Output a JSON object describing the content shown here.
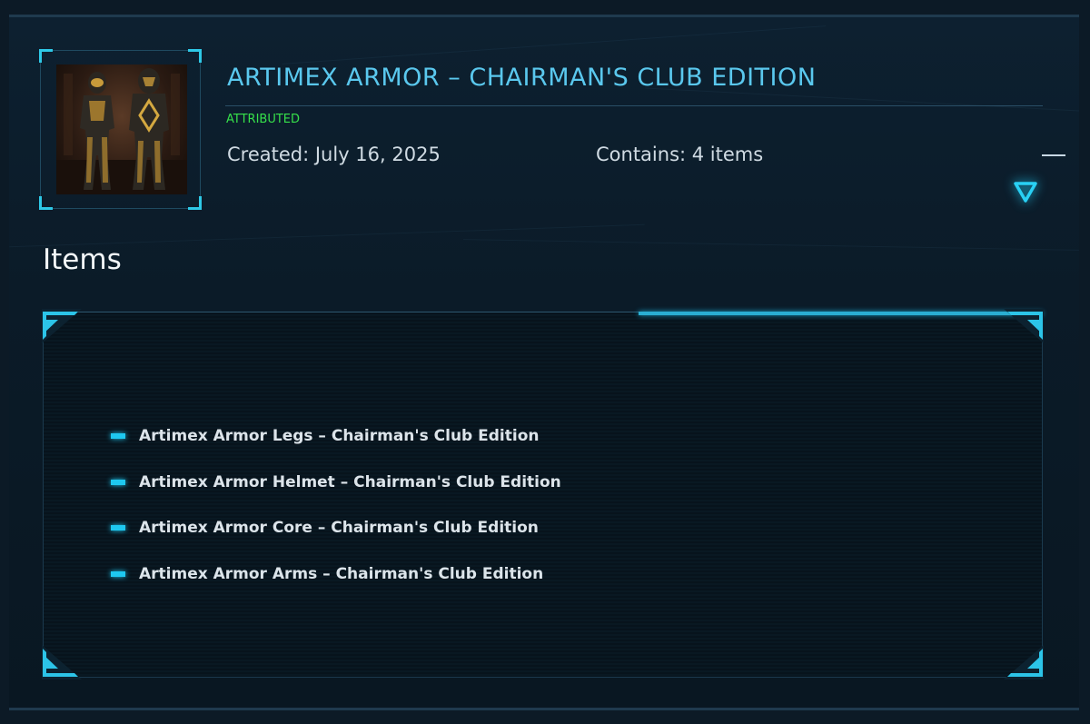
{
  "pledge": {
    "title": "ARTIMEX ARMOR – CHAIRMAN'S CLUB EDITION",
    "status": "ATTRIBUTED",
    "created": "Created: July 16, 2025",
    "contains": "Contains: 4 items"
  },
  "items_section": {
    "heading": "Items",
    "items": [
      "Artimex Armor Legs – Chairman's Club Edition",
      "Artimex Armor Helmet – Chairman's Club Edition",
      "Artimex Armor Core – Chairman's Club Edition",
      "Artimex Armor Arms – Chairman's Club Edition"
    ]
  },
  "icons": {
    "toggle": "chevron-down-triangle-icon",
    "collapse": "minus-icon",
    "bullet": "dash-bullet-icon"
  },
  "colors": {
    "accent": "#1ec8f0",
    "title": "#5ac8ee",
    "status": "#36e04a",
    "background": "#0b1b28"
  }
}
